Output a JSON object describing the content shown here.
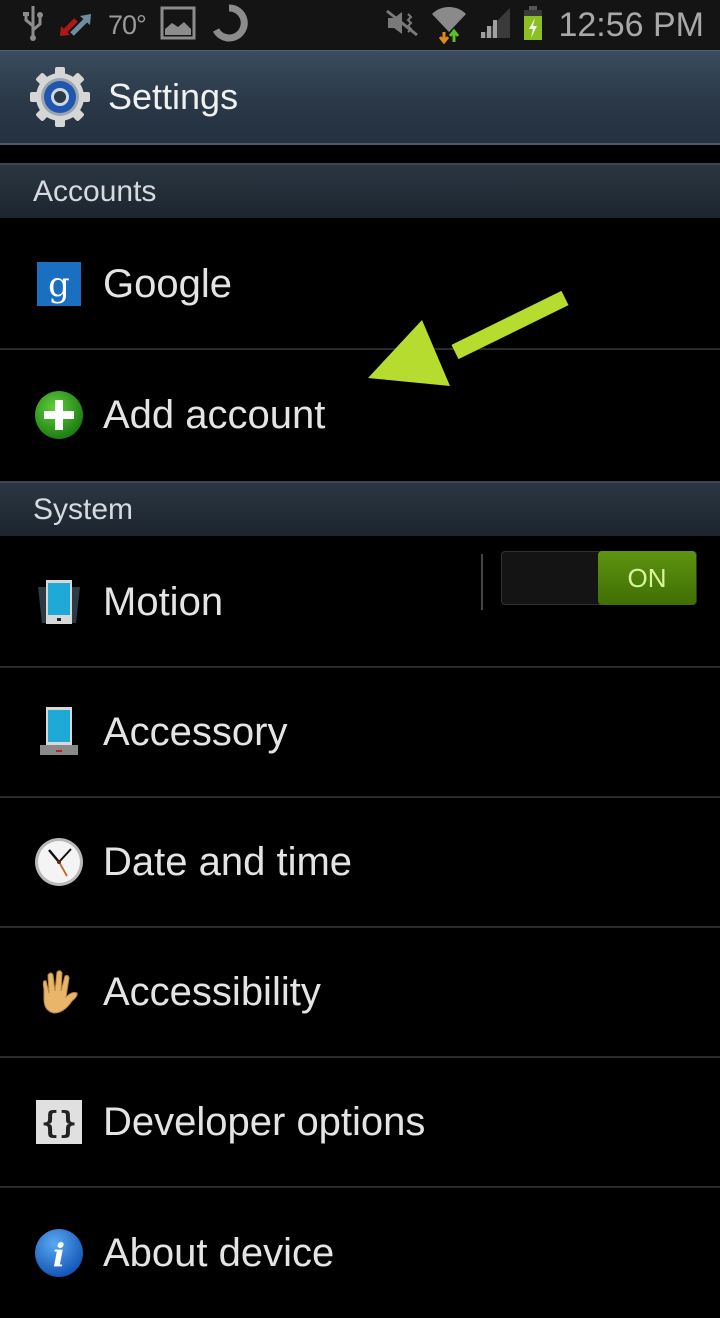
{
  "status_bar": {
    "temperature": "70°",
    "time": "12:56 PM",
    "icons_left": [
      "usb-icon",
      "data-transfer-icon",
      "temperature",
      "gallery-icon",
      "sync-icon"
    ],
    "icons_right": [
      "mute-icon",
      "wifi-icon",
      "signal-icon",
      "battery-charging-icon"
    ]
  },
  "action_bar": {
    "title": "Settings",
    "icon": "settings-gear-icon"
  },
  "sections": [
    {
      "header": "Accounts",
      "items": [
        {
          "label": "Google",
          "icon": "google-icon"
        },
        {
          "label": "Add account",
          "icon": "add-icon"
        }
      ]
    },
    {
      "header": "System",
      "items": [
        {
          "label": "Motion",
          "icon": "motion-icon",
          "toggle": {
            "state": "ON",
            "on": true
          }
        },
        {
          "label": "Accessory",
          "icon": "accessory-icon"
        },
        {
          "label": "Date and time",
          "icon": "clock-icon"
        },
        {
          "label": "Accessibility",
          "icon": "hand-icon"
        },
        {
          "label": "Developer options",
          "icon": "developer-braces-icon"
        },
        {
          "label": "About device",
          "icon": "info-icon"
        }
      ]
    }
  ],
  "annotation": {
    "type": "arrow",
    "color": "#b5dc2e",
    "points_to": "Add account"
  },
  "colors": {
    "toggle_on": "#4f8508",
    "toggle_text": "#d8f59a",
    "section_bg": "#222c36"
  }
}
